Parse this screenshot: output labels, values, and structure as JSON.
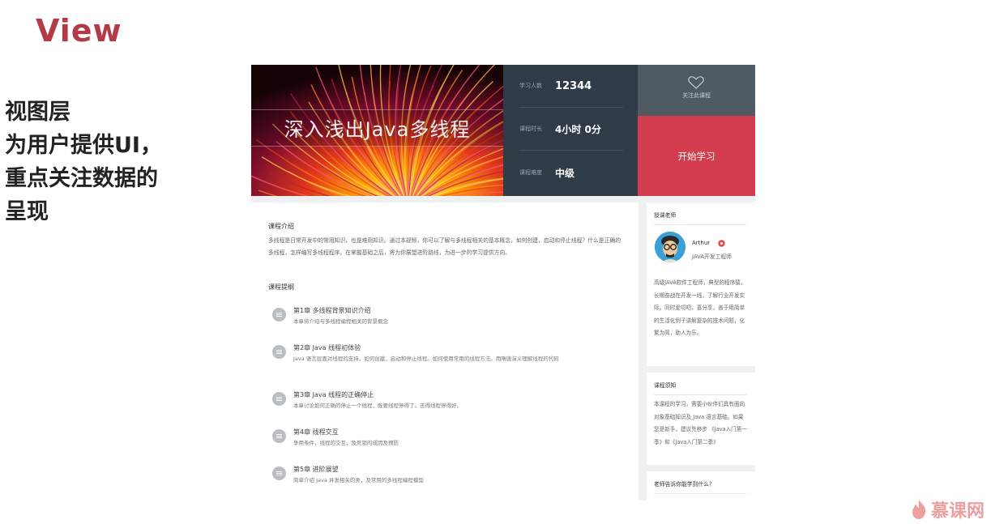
{
  "slide": {
    "title": "View",
    "desc_lines": [
      "视图层",
      "为用户提供UI，",
      "重点关注数据的",
      "呈现"
    ],
    "brand": "慕课网"
  },
  "course": {
    "banner_title": "深入浅出Java多线程",
    "stats": [
      {
        "label": "学习人数",
        "value": "12344"
      },
      {
        "label": "课程时长",
        "value": "4小时 0分"
      },
      {
        "label": "课程难度",
        "value": "中级"
      }
    ],
    "follow_label": "关注此课程",
    "start_label": "开始学习"
  },
  "intro": {
    "title": "课程介绍",
    "text": "多线程是日常开发中的常用知识，也是难用知识。通过本视频，你可以了解与多线程相关的基本概念，如何创建，启动和停止线程？什么是正确的多线程，怎样编写多线程程序。在掌握基础之后，将为你展望进阶路线，为进一步的学习提供方向。"
  },
  "outline": {
    "title": "课程提纲",
    "chapters": [
      {
        "title": "第1章 多线程背景知识介绍",
        "desc": "本章将介绍与多线程编程相关的背景概念"
      },
      {
        "title": "第2章 Java 线程初体验",
        "desc": "Java 语言层面对线程的支持，如何创建，启动和停止线程。如何使用常用的线程方法。用隋唐演义理解线程的代码"
      },
      {
        "title": "第3章 Java 线程的正确停止",
        "desc": "本章讨论如何正确的停止一个线程，既要线程停得了，还得线程停得好。"
      },
      {
        "title": "第4章 线程交互",
        "desc": "争用条件，线程的交互，及死锁的成因及预防"
      },
      {
        "title": "第5章 进阶展望",
        "desc": "简单介绍 Java 并发相关的类，及常用的多线程编程模型"
      }
    ]
  },
  "teacher": {
    "head": "授课老师",
    "name": "Arthur",
    "title": "JAVA开发工程师",
    "bio": "高级JAVA软件工程师，典型的程序猿，长期奋战在开发一线，了解行业开发实际。同时爱叨叨，喜分享，善于用简单的生活化例子讲解复杂的技术问题，化繁为简，助人为乐。"
  },
  "notice": {
    "head": "课程须知",
    "text": "本课程的学习，需要小伙伴们具有面向对象基础知识及 Java 语言基础。如果您是新手，建议先移步 《Java入门第一季》和《Java入门第二季》"
  },
  "learn": {
    "head": "老师告诉你能学到什么？"
  },
  "colors": {
    "accent": "#d43d4e",
    "title_red": "#b43a48",
    "stats_bg": "#2f3c47"
  }
}
